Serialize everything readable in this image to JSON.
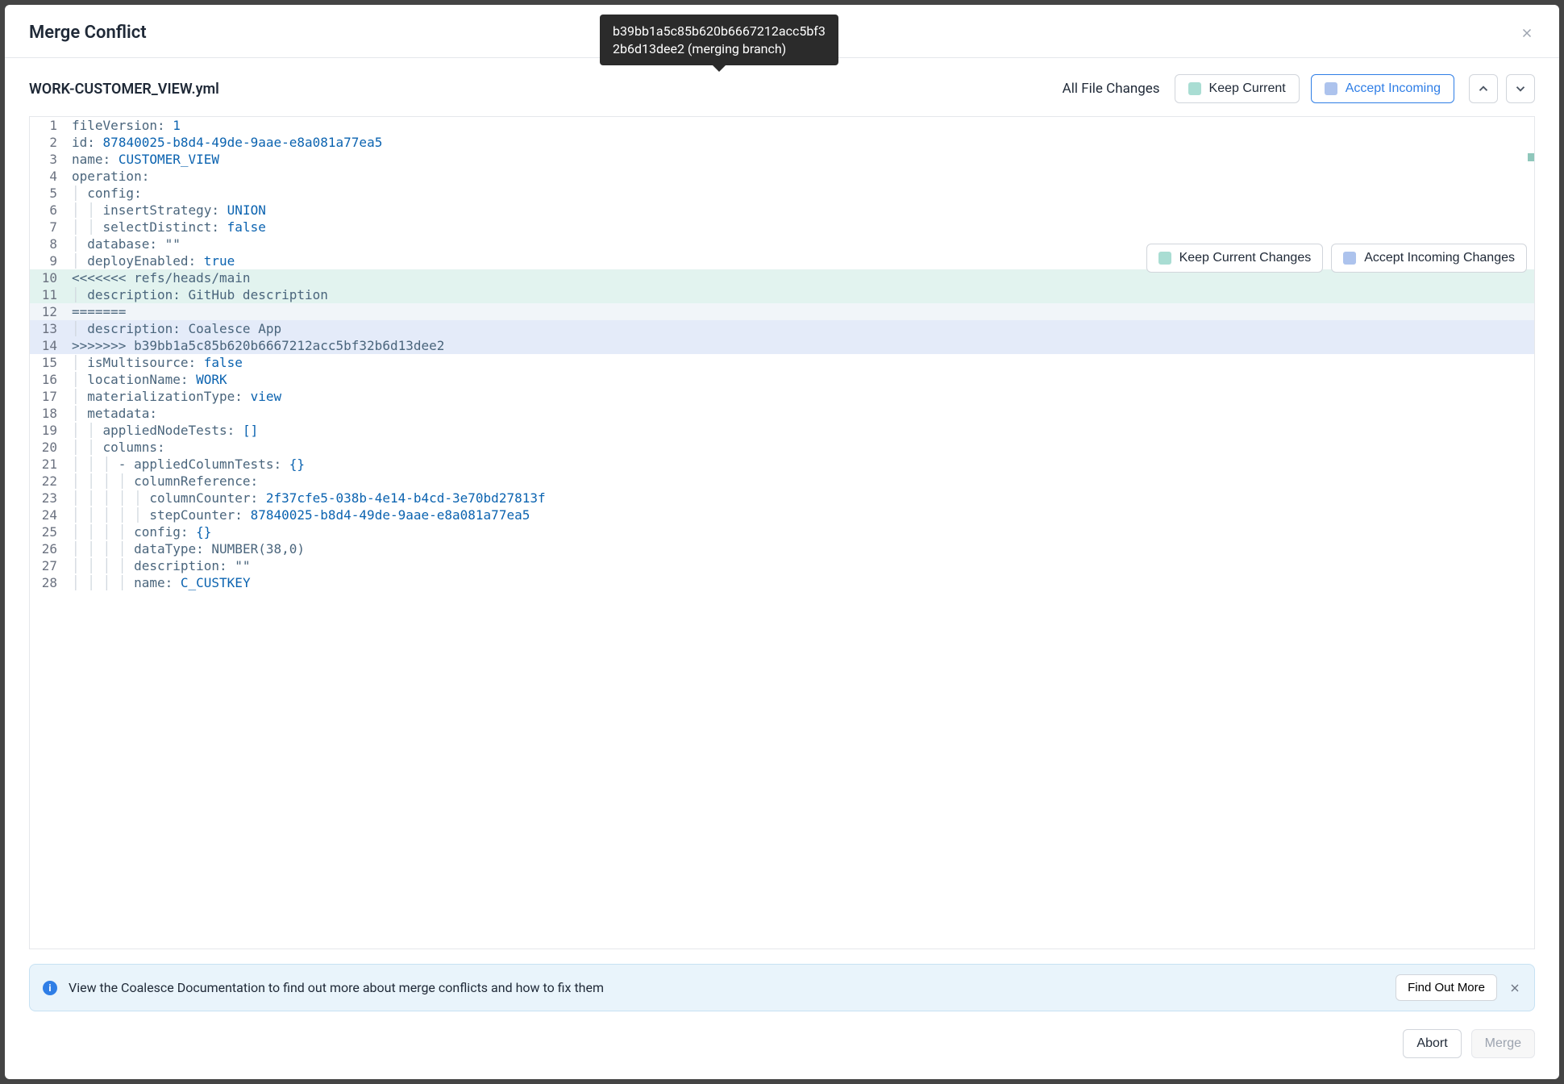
{
  "header": {
    "title": "Merge Conflict"
  },
  "tooltip": {
    "line1": "b39bb1a5c85b620b6667212acc5bf3",
    "line2": "2b6d13dee2 (merging branch)"
  },
  "toolbar": {
    "filename": "WORK-CUSTOMER_VIEW.yml",
    "all_changes": "All File Changes",
    "keep_current": "Keep Current",
    "accept_incoming": "Accept Incoming"
  },
  "inline": {
    "keep": "Keep Current Changes",
    "accept": "Accept Incoming Changes"
  },
  "info": {
    "text": "View the Coalesce Documentation to find out more about merge conflicts and how to fix them",
    "button": "Find Out More"
  },
  "footer": {
    "abort": "Abort",
    "merge": "Merge"
  },
  "code": {
    "lines": [
      {
        "n": 1,
        "cls": "",
        "html": "<span class='tok-key'>fileVersion:</span> <span class='tok-val'>1</span>"
      },
      {
        "n": 2,
        "cls": "",
        "html": "<span class='tok-key'>id:</span> <span class='tok-val'>87840025-b8d4-49de-9aae-e8a081a77ea5</span>"
      },
      {
        "n": 3,
        "cls": "",
        "html": "<span class='tok-key'>name:</span> <span class='tok-val'>CUSTOMER_VIEW</span>"
      },
      {
        "n": 4,
        "cls": "",
        "html": "<span class='tok-key'>operation:</span>"
      },
      {
        "n": 5,
        "cls": "",
        "html": "<span class='indent-guide'>│ </span><span class='tok-key'>config:</span>"
      },
      {
        "n": 6,
        "cls": "",
        "html": "<span class='indent-guide'>│ │ </span><span class='tok-key'>insertStrategy:</span> <span class='tok-val'>UNION</span>"
      },
      {
        "n": 7,
        "cls": "",
        "html": "<span class='indent-guide'>│ │ </span><span class='tok-key'>selectDistinct:</span> <span class='tok-bool'>false</span>"
      },
      {
        "n": 8,
        "cls": "",
        "html": "<span class='indent-guide'>│ </span><span class='tok-key'>database:</span> <span class='tok-str'>\"\"</span>"
      },
      {
        "n": 9,
        "cls": "",
        "html": "<span class='indent-guide'>│ </span><span class='tok-key'>deployEnabled:</span> <span class='tok-bool'>true</span>"
      },
      {
        "n": 10,
        "cls": "current",
        "html": "<span class='tok-marker'>&lt;&lt;&lt;&lt;&lt;&lt;&lt; refs/heads/main</span>"
      },
      {
        "n": 11,
        "cls": "current",
        "html": "<span class='indent-guide'>│ </span><span class='tok-key'>description:</span> <span class='tok-str'>GitHub description</span>"
      },
      {
        "n": 12,
        "cls": "sep",
        "html": "<span class='tok-marker'>=======</span>"
      },
      {
        "n": 13,
        "cls": "incoming",
        "html": "<span class='indent-guide'>│ </span><span class='tok-key'>description:</span> <span class='tok-str'>Coalesce App</span>"
      },
      {
        "n": 14,
        "cls": "incoming",
        "html": "<span class='tok-marker'>&gt;&gt;&gt;&gt;&gt;&gt;&gt; b39bb1a5c85b620b6667212acc5bf32b6d13dee2</span>"
      },
      {
        "n": 15,
        "cls": "",
        "html": "<span class='indent-guide'>│ </span><span class='tok-key'>isMultisource:</span> <span class='tok-bool'>false</span>"
      },
      {
        "n": 16,
        "cls": "",
        "html": "<span class='indent-guide'>│ </span><span class='tok-key'>locationName:</span> <span class='tok-val'>WORK</span>"
      },
      {
        "n": 17,
        "cls": "",
        "html": "<span class='indent-guide'>│ </span><span class='tok-key'>materializationType:</span> <span class='tok-val'>view</span>"
      },
      {
        "n": 18,
        "cls": "",
        "html": "<span class='indent-guide'>│ </span><span class='tok-key'>metadata:</span>"
      },
      {
        "n": 19,
        "cls": "",
        "html": "<span class='indent-guide'>│ │ </span><span class='tok-key'>appliedNodeTests:</span> <span class='tok-val'>[]</span>"
      },
      {
        "n": 20,
        "cls": "",
        "html": "<span class='indent-guide'>│ │ </span><span class='tok-key'>columns:</span>"
      },
      {
        "n": 21,
        "cls": "",
        "html": "<span class='indent-guide'>│ │ │ </span><span class='tok-key'>- appliedColumnTests:</span> <span class='tok-val'>{}</span>"
      },
      {
        "n": 22,
        "cls": "",
        "html": "<span class='indent-guide'>│ │ │ │ </span><span class='tok-key'>columnReference:</span>"
      },
      {
        "n": 23,
        "cls": "",
        "html": "<span class='indent-guide'>│ │ │ │ │ </span><span class='tok-key'>columnCounter:</span> <span class='tok-val'>2f37cfe5-038b-4e14-b4cd-3e70bd27813f</span>"
      },
      {
        "n": 24,
        "cls": "",
        "html": "<span class='indent-guide'>│ │ │ │ │ </span><span class='tok-key'>stepCounter:</span> <span class='tok-val'>87840025-b8d4-49de-9aae-e8a081a77ea5</span>"
      },
      {
        "n": 25,
        "cls": "",
        "html": "<span class='indent-guide'>│ │ │ │ </span><span class='tok-key'>config:</span> <span class='tok-val'>{}</span>"
      },
      {
        "n": 26,
        "cls": "",
        "html": "<span class='indent-guide'>│ │ │ │ </span><span class='tok-key'>dataType:</span> <span class='tok-str'>NUMBER(38,0)</span>"
      },
      {
        "n": 27,
        "cls": "",
        "html": "<span class='indent-guide'>│ │ │ │ </span><span class='tok-key'>description:</span> <span class='tok-str'>\"\"</span>"
      },
      {
        "n": 28,
        "cls": "",
        "html": "<span class='indent-guide'>│ │ │ │ </span><span class='tok-key'>name:</span> <span class='tok-val'>C_CUSTKEY</span>"
      }
    ]
  }
}
